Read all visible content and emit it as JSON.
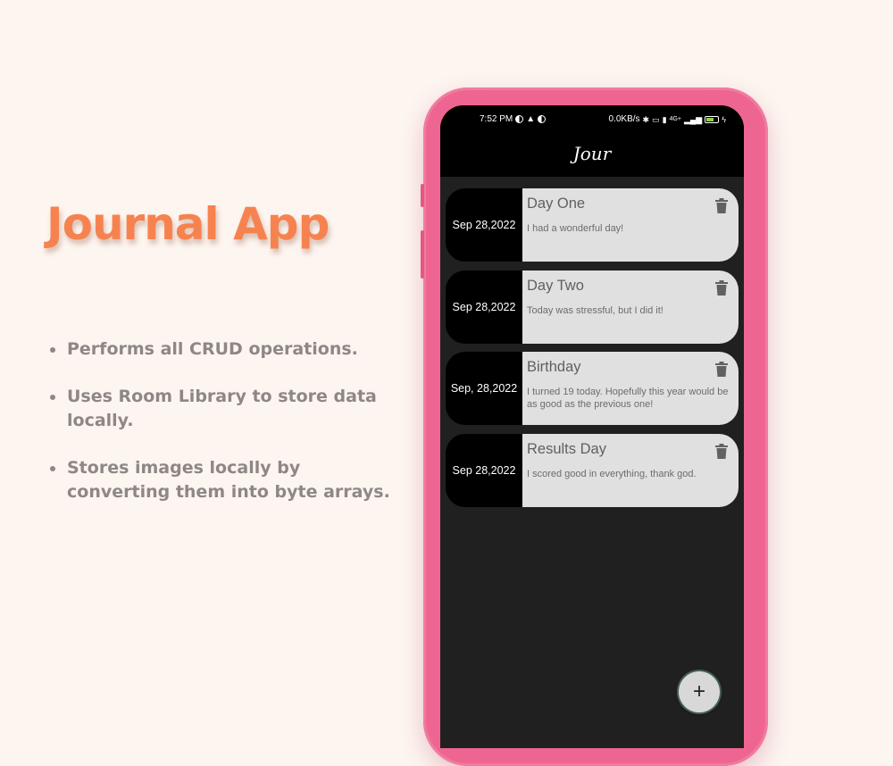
{
  "promo": {
    "title": "Journal App",
    "features": [
      "Performs all CRUD operations.",
      "Uses Room Library to store data locally.",
      "Stores images locally by converting them into byte arrays."
    ]
  },
  "status_bar": {
    "time": "7:52 PM",
    "speed": "0.0KB/s",
    "network": "4G+",
    "battery": "42"
  },
  "app": {
    "title": "Jour",
    "entries": [
      {
        "date": "Sep 28,2022",
        "title": "Day One",
        "text": "I had a wonderful day!"
      },
      {
        "date": "Sep 28,2022",
        "title": "Day Two",
        "text": "Today was stressful, but I did it!"
      },
      {
        "date": "Sep, 28,2022",
        "title": "Birthday",
        "text": "I turned 19 today. Hopefully this year would be as good as the previous one!"
      },
      {
        "date": "Sep 28,2022",
        "title": "Results Day",
        "text": "I scored good in everything, thank god."
      }
    ],
    "fab_label": "+"
  },
  "colors": {
    "background": "#fdf5f0",
    "accent": "#f6834f",
    "phone_frame": "#ef6592",
    "screen": "#202020",
    "card_body": "#e0e0e0"
  },
  "icons": [
    "delete-icon",
    "add-icon",
    "bluetooth-icon",
    "battery-icon",
    "signal-icon"
  ]
}
